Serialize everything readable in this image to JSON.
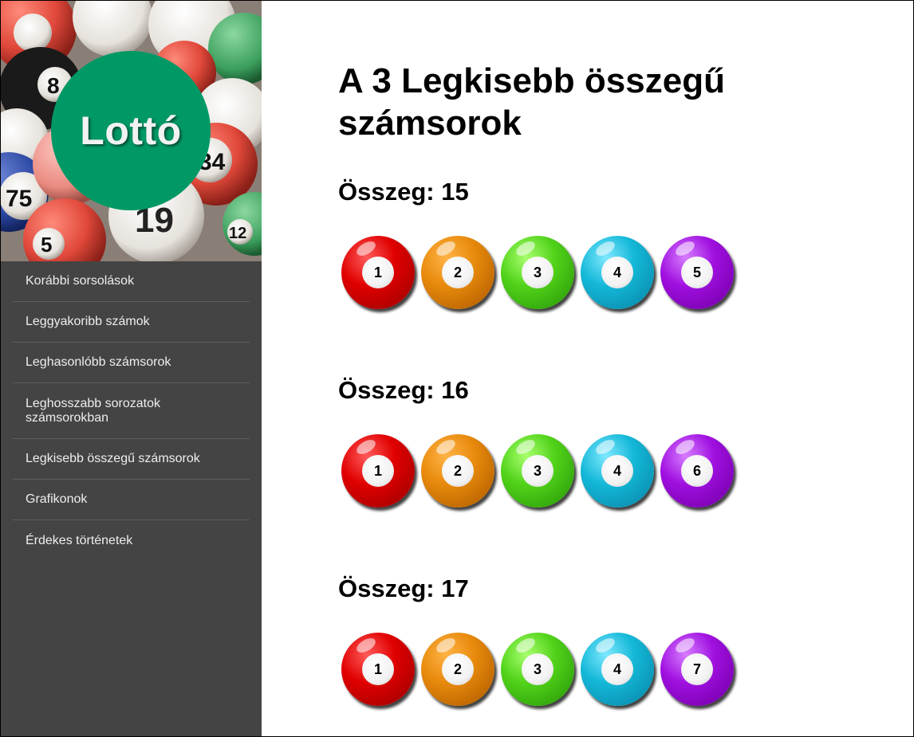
{
  "logo": {
    "text": "Lottó"
  },
  "hero": {
    "ball_numbers": [
      "8",
      "75",
      "19",
      "34",
      "5",
      "12"
    ]
  },
  "nav": {
    "items": [
      {
        "label": "Korábbi sorsolások"
      },
      {
        "label": "Leggyakoribb számok"
      },
      {
        "label": "Leghasonlóbb számsorok"
      },
      {
        "label": "Leghosszabb sorozatok számsorokban"
      },
      {
        "label": "Legkisebb összegű számsorok"
      },
      {
        "label": "Grafikonok"
      },
      {
        "label": "Érdekes történetek"
      }
    ]
  },
  "main": {
    "title": "A 3 Legkisebb összegű számsorok",
    "groups": [
      {
        "heading": "Összeg: 15",
        "balls": [
          "1",
          "2",
          "3",
          "4",
          "5"
        ]
      },
      {
        "heading": "Összeg: 16",
        "balls": [
          "1",
          "2",
          "3",
          "4",
          "6"
        ]
      },
      {
        "heading": "Összeg: 17",
        "balls": [
          "1",
          "2",
          "3",
          "4",
          "7"
        ]
      }
    ],
    "ball_colors": [
      "#e00000",
      "#e88a0c",
      "#52d31a",
      "#14b8d8",
      "#a010e0"
    ]
  },
  "colors": {
    "sidebar_bg": "#444444",
    "logo_circle": "#009966",
    "nav_text": "#eeeeee"
  }
}
